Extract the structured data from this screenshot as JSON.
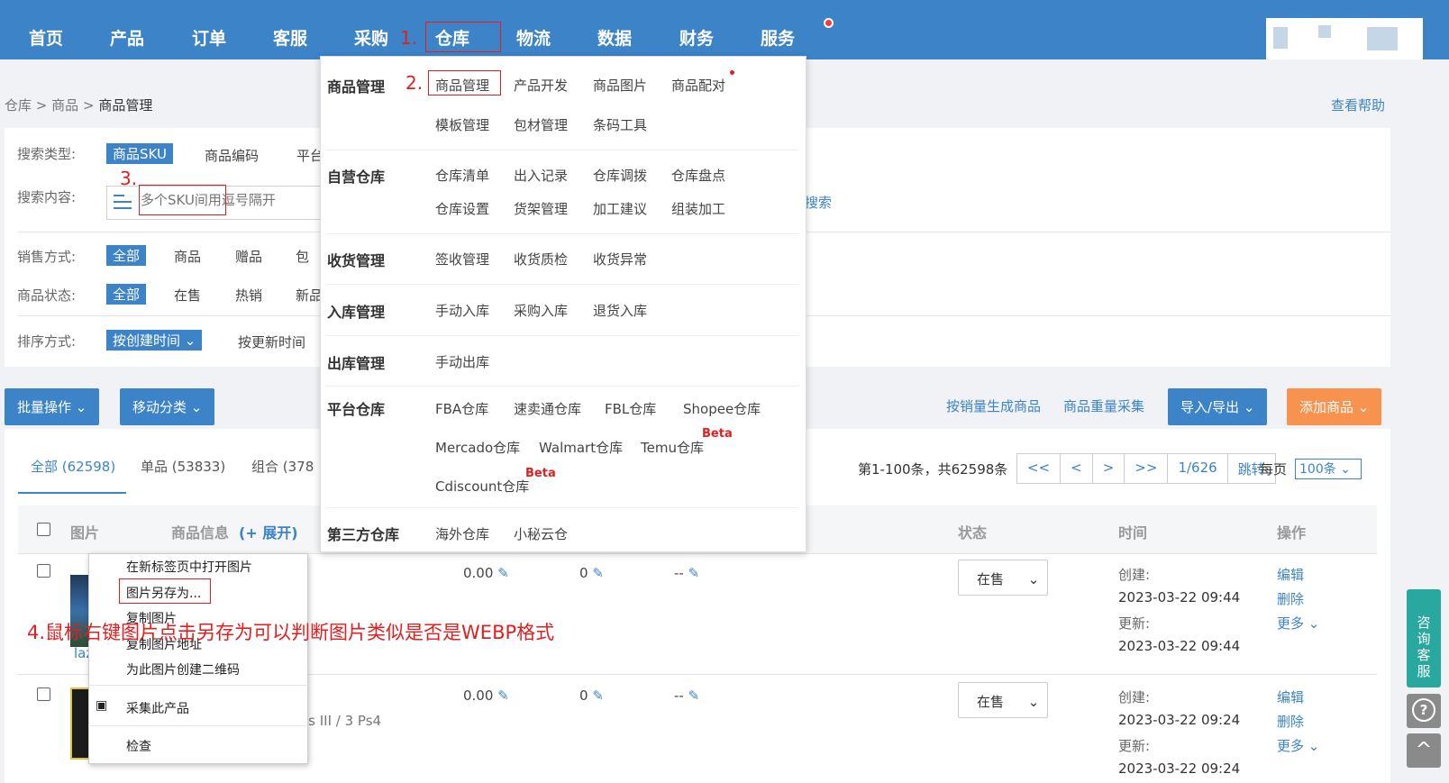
{
  "top_nav": {
    "items": [
      "首页",
      "产品",
      "订单",
      "客服",
      "采购",
      "仓库",
      "物流",
      "数据",
      "财务",
      "服务"
    ],
    "active": "仓库"
  },
  "breadcrumb": {
    "part1": "仓库",
    "part2": "商品",
    "current": "商品管理",
    "sep": ">"
  },
  "help": "查看帮助",
  "filters": {
    "search_type_label": "搜索类型:",
    "search_type_active": "商品SKU",
    "search_type_opt1": "商品编码",
    "search_type_opt2": "平台",
    "search_content_label": "搜索内容:",
    "search_placeholder": "多个SKU间用逗号隔开",
    "search_button": "搜索",
    "sale_label": "销售方式:",
    "sale_all": "全部",
    "sale_opt1": "商品",
    "sale_opt2": "赠品",
    "sale_opt3": "包",
    "status_label": "商品状态:",
    "status_all": "全部",
    "status_opt1": "在售",
    "status_opt2": "热销",
    "status_opt3": "新品",
    "sort_label": "排序方式:",
    "sort_active": "按创建时间",
    "sort_opt1": "按更新时间"
  },
  "toolbar": {
    "batch": "批量操作",
    "move": "移动分类",
    "gen_by_sales": "按销量生成商品",
    "recollect": "商品重量采集",
    "import_export": "导入/导出",
    "add_product": "添加商品"
  },
  "tabs": {
    "all": "全部 (62598)",
    "single": "单品 (53833)",
    "combo": "组合 (378"
  },
  "pager": {
    "summary": "第1-100条，共62598条",
    "first": "<<",
    "prev": "<",
    "next": ">",
    "last": ">>",
    "page": "1/626",
    "jump": "跳转",
    "per_page_label": "每页",
    "per_page": "100条"
  },
  "table": {
    "col_image": "图片",
    "col_info": "商品信息",
    "col_expand": "(+ 展开)",
    "col_status": "状态",
    "col_time": "时间",
    "col_ops": "操作",
    "rows": [
      {
        "price": "0.00",
        "stock": "0",
        "dash": "--",
        "status": "在售",
        "created_label": "创建:",
        "created": "2023-03-22 09:44",
        "updated_label": "更新:",
        "updated": "2023-03-22 09:44",
        "edit": "编辑",
        "delete": "删除",
        "more": "更多",
        "partial": "laz"
      },
      {
        "price": "0.00",
        "stock": "0",
        "dash": "--",
        "status": "在售",
        "created_label": "创建:",
        "created": "2023-03-22 09:24",
        "updated_label": "更新:",
        "updated": "2023-03-22 09:24",
        "edit": "编辑",
        "delete": "删除",
        "more": "更多",
        "partial": "os III / 3 Ps4"
      }
    ]
  },
  "mega_menu": {
    "s1_title": "商品管理",
    "s1_items": [
      "商品管理",
      "产品开发",
      "商品图片",
      "商品配对",
      "模板管理",
      "包材管理",
      "条码工具"
    ],
    "s2_title": "自营仓库",
    "s2_items": [
      "仓库清单",
      "出入记录",
      "仓库调拨",
      "仓库盘点",
      "仓库设置",
      "货架管理",
      "加工建议",
      "组装加工"
    ],
    "s3_title": "收货管理",
    "s3_items": [
      "签收管理",
      "收货质检",
      "收货异常"
    ],
    "s4_title": "入库管理",
    "s4_items": [
      "手动入库",
      "采购入库",
      "退货入库"
    ],
    "s5_title": "出库管理",
    "s5_items": [
      "手动出库"
    ],
    "s6_title": "平台仓库",
    "s6_items": [
      "FBA仓库",
      "速卖通仓库",
      "FBL仓库",
      "Shopee仓库",
      "Mercado仓库",
      "Walmart仓库",
      "Temu仓库",
      "Cdiscount仓库"
    ],
    "beta": "Beta",
    "s7_title": "第三方仓库",
    "s7_items": [
      "海外仓库",
      "小秘云仓"
    ]
  },
  "context_menu": {
    "open_new_tab": "在新标签页中打开图片",
    "save_as": "图片另存为...",
    "copy": "复制图片",
    "copy_addr": "复制图片地址",
    "qrcode": "为此图片创建二维码",
    "collect": "采集此产品",
    "inspect": "检查"
  },
  "annotations": {
    "a1": "1.",
    "a2": "2.",
    "a3": "3.",
    "a4": "4.鼠标右键图片点击另存为可以判断图片类似是否是WEBP格式"
  },
  "side": {
    "service": [
      "咨",
      "询",
      "客",
      "服"
    ],
    "help": "?",
    "top": "^"
  },
  "colors": {
    "primary": "#3d83c8",
    "orange": "#f7934f",
    "annotation": "#e02020",
    "service": "#29a8a0"
  }
}
